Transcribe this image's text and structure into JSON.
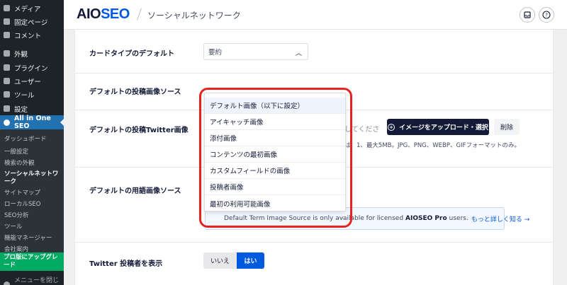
{
  "sidebar": {
    "items": [
      {
        "label": "メディア"
      },
      {
        "label": "固定ページ"
      },
      {
        "label": "コメント"
      },
      {
        "label": "外観"
      },
      {
        "label": "プラグイン"
      },
      {
        "label": "ユーザー"
      },
      {
        "label": "ツール"
      },
      {
        "label": "設定"
      }
    ],
    "active_label": "All in One SEO",
    "submenu": [
      {
        "label": "ダッシュボード"
      },
      {
        "label": "一般設定"
      },
      {
        "label": "検索の外観"
      },
      {
        "label": "ソーシャルネットワーク"
      },
      {
        "label": "サイトマップ"
      },
      {
        "label": "ローカルSEO"
      },
      {
        "label": "SEO分析"
      },
      {
        "label": "ツール"
      },
      {
        "label": "機能マネージャー"
      },
      {
        "label": "会社案内"
      }
    ],
    "upgrade_label": "プロ版にアップグレード",
    "collapse_label": "メニューを閉じる"
  },
  "header": {
    "logo_aio": "AIO",
    "logo_seo": "SEO",
    "title": "ソーシャルネットワーク"
  },
  "form": {
    "card_type_label": "カードタイプのデフォルト",
    "card_type_value": "要約",
    "post_image_source_label": "デフォルトの投稿画像ソース",
    "twitter_image_label": "デフォルトの投稿Twitter画像",
    "twitter_image_input_text": "してくださ",
    "upload_button": "イメージをアップロード・選択",
    "delete_button": "削除",
    "hint_text": "は：1、最大5MB。JPG、PNG、WEBP、GIFフォーマットのみ。",
    "term_image_source_label": "デフォルトの用語画像ソース",
    "notice_pre": "Default Term Image Source is only available for licensed",
    "notice_brand": "AIOSEO Pro",
    "notice_post": "users.",
    "notice_link": "もっと詳しく知る →",
    "twitter_author_label": "Twitter 投稿者を表示",
    "toggle_no": "いいえ",
    "toggle_yes": "はい"
  },
  "dropdown": {
    "options": [
      {
        "label": "デフォルト画像（以下に設定）"
      },
      {
        "label": "アイキャッチ画像"
      },
      {
        "label": "添付画像"
      },
      {
        "label": "コンテンツの最初画像"
      },
      {
        "label": "カスタムフィールドの画像"
      },
      {
        "label": "投稿者画像"
      },
      {
        "label": "最初の利用可能画像"
      }
    ],
    "selected_index": 0
  },
  "colors": {
    "sidebar_bg": "#1d2327",
    "active_blue": "#2271b1",
    "upgrade_green": "#00aa63",
    "aioseo_blue": "#005ae0",
    "dark_navy": "#141b38",
    "highlight_red": "#e6241f"
  },
  "icons": {
    "inbox": "inbox-icon",
    "help": "help-icon",
    "plus": "plus-circle-icon",
    "chevron": "chevron-up-icon"
  }
}
